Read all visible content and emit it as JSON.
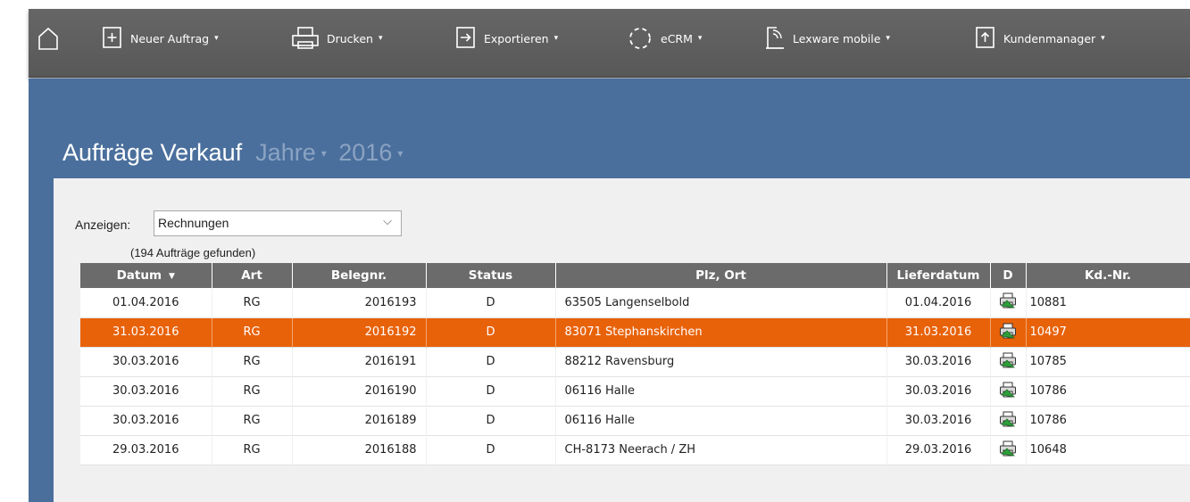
{
  "toolbar": {
    "items": [
      {
        "label": "Neuer Auftrag",
        "icon": "new-document-icon"
      },
      {
        "label": "Drucken",
        "icon": "printer-icon"
      },
      {
        "label": "Exportieren",
        "icon": "export-icon"
      },
      {
        "label": "eCRM",
        "icon": "ecrm-icon"
      },
      {
        "label": "Lexware mobile",
        "icon": "mobile-icon"
      },
      {
        "label": "Kundenmanager",
        "icon": "upload-document-icon"
      }
    ],
    "caret": "▾",
    "home_icon": "home-icon"
  },
  "page": {
    "title": "Aufträge Verkauf",
    "years_label": "Jahre",
    "year": "2016",
    "caret": "▾"
  },
  "filter": {
    "label": "Anzeigen:",
    "selected": "Rechnungen",
    "found": "(194 Aufträge gefunden)"
  },
  "table": {
    "columns": [
      "Datum",
      "Art",
      "Belegnr.",
      "Status",
      "Plz, Ort",
      "Lieferdatum",
      "D",
      "Kd.-Nr."
    ],
    "sort_indicator": "▼",
    "rows": [
      {
        "datum": "01.04.2016",
        "art": "RG",
        "belegnr": "2016193",
        "status": "D",
        "ort": "63505 Langenselbold",
        "lieferdatum": "01.04.2016",
        "kdnr": "10881",
        "selected": false
      },
      {
        "datum": "31.03.2016",
        "art": "RG",
        "belegnr": "2016192",
        "status": "D",
        "ort": "83071 Stephanskirchen",
        "lieferdatum": "31.03.2016",
        "kdnr": "10497",
        "selected": true
      },
      {
        "datum": "30.03.2016",
        "art": "RG",
        "belegnr": "2016191",
        "status": "D",
        "ort": "88212 Ravensburg",
        "lieferdatum": "30.03.2016",
        "kdnr": "10785",
        "selected": false
      },
      {
        "datum": "30.03.2016",
        "art": "RG",
        "belegnr": "2016190",
        "status": "D",
        "ort": "06116 Halle",
        "lieferdatum": "30.03.2016",
        "kdnr": "10786",
        "selected": false
      },
      {
        "datum": "30.03.2016",
        "art": "RG",
        "belegnr": "2016189",
        "status": "D",
        "ort": "06116 Halle",
        "lieferdatum": "30.03.2016",
        "kdnr": "10786",
        "selected": false
      },
      {
        "datum": "29.03.2016",
        "art": "RG",
        "belegnr": "2016188",
        "status": "D",
        "ort": "CH-8173 Neerach / ZH",
        "lieferdatum": "29.03.2016",
        "kdnr": "10648",
        "selected": false
      }
    ]
  },
  "colors": {
    "toolbar": "#5f5f5f",
    "background": "#4a6f9c",
    "header": "#6b6b6b",
    "selected_row": "#e8620a"
  }
}
